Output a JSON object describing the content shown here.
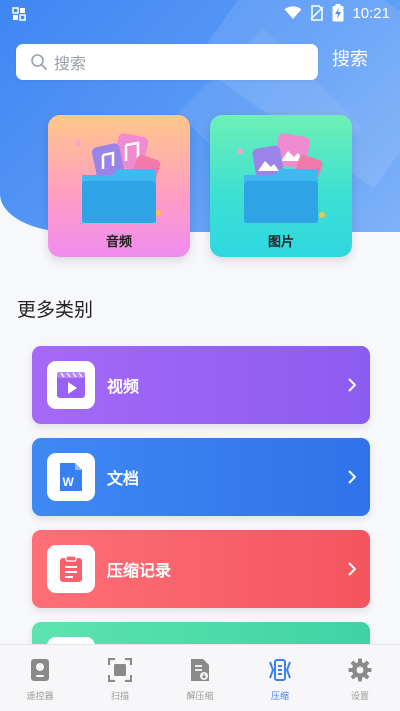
{
  "status_bar": {
    "time": "10:21"
  },
  "search": {
    "placeholder": "搜索",
    "button_label": "搜索"
  },
  "categories": [
    {
      "label": "音频"
    },
    {
      "label": "图片"
    }
  ],
  "section_title": "更多类别",
  "list": [
    {
      "label": "视频"
    },
    {
      "label": "文档"
    },
    {
      "label": "压缩记录"
    }
  ],
  "tabs": [
    {
      "label": "遥控器",
      "icon": "remote-icon",
      "active": false
    },
    {
      "label": "扫描",
      "icon": "scan-icon",
      "active": false
    },
    {
      "label": "解压缩",
      "icon": "unzip-icon",
      "active": false
    },
    {
      "label": "压缩",
      "icon": "compress-icon",
      "active": true
    },
    {
      "label": "设置",
      "icon": "gear-icon",
      "active": false
    }
  ],
  "colors": {
    "accent": "#3d7ff2",
    "video": "#9a62f4",
    "document": "#3880f1",
    "record": "#f8616a",
    "extra": "#4ddcab"
  }
}
